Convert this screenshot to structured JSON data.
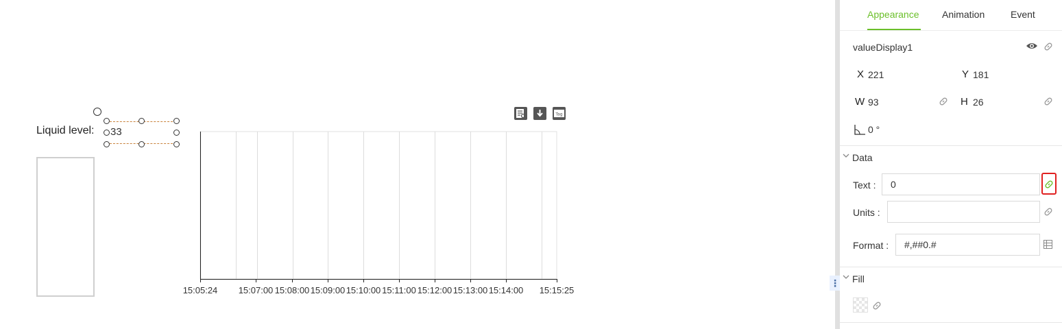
{
  "canvas": {
    "liquid_label": "Liquid level:",
    "value_display": "33"
  },
  "chart_data": {
    "type": "line",
    "x_tick_labels": [
      "15:05:24",
      "15:07:00",
      "15:08:00",
      "15:09:00",
      "15:10:00",
      "15:11:00",
      "15:12:00",
      "15:13:00",
      "15:14:00",
      "15:15:25"
    ],
    "series": [],
    "grid": true,
    "toolbar_icons": [
      "view-data-icon",
      "download-icon",
      "tag-icon"
    ]
  },
  "panel": {
    "tabs": [
      {
        "label": "Appearance",
        "active": true
      },
      {
        "label": "Animation",
        "active": false
      },
      {
        "label": "Event",
        "active": false
      }
    ],
    "component_name": "valueDisplay1",
    "x_label": "X",
    "x_value": "221",
    "y_label": "Y",
    "y_value": "181",
    "w_label": "W",
    "w_value": "93",
    "h_label": "H",
    "h_value": "26",
    "rotation_value": "0 °",
    "data_section": {
      "title": "Data",
      "text_label": "Text :",
      "text_value": "0",
      "units_label": "Units :",
      "units_value": "",
      "format_label": "Format :",
      "format_value": "#,##0.#"
    },
    "fill_section": {
      "title": "Fill"
    },
    "colors": {
      "accent": "#6bbf2a",
      "highlight": "#e02020"
    }
  }
}
